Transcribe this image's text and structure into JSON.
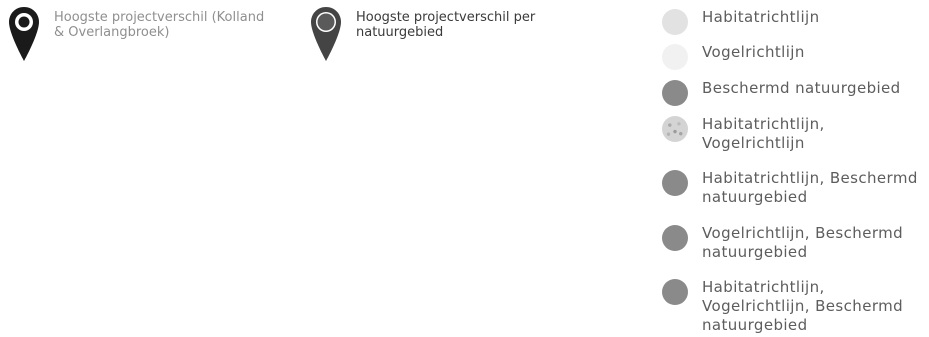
{
  "pin_legend": [
    {
      "label": "Hoogste projectverschil (Kolland\n& Overlangbroek)",
      "pin_color": "#1a1a1a",
      "center_style": "ring",
      "text_color": "#8f8f8f"
    },
    {
      "label": "Hoogste projectverschil per\nnatuurgebied",
      "pin_color": "#444444",
      "center_style": "filled",
      "text_color": "#3a3a3a"
    }
  ],
  "area_legend": [
    {
      "label": "Habitatrichtlijn",
      "color": "#e2e2e2",
      "pattern": "solid"
    },
    {
      "label": "Vogelrichtlijn",
      "color": "#f1f1f1",
      "pattern": "solid"
    },
    {
      "label": "Beschermd natuurgebied",
      "color": "#8a8a8a",
      "pattern": "solid"
    },
    {
      "label": "Habitatrichtlijn,\nVogelrichtlijn",
      "color": "#d4d4d4",
      "pattern": "dotted"
    },
    {
      "label": "Habitatrichtlijn, Beschermd\nnatuurgebied",
      "color": "#8a8a8a",
      "pattern": "solid"
    },
    {
      "label": "Vogelrichtlijn, Beschermd\nnatuurgebied",
      "color": "#8a8a8a",
      "pattern": "solid"
    },
    {
      "label": "Habitatrichtlijn,\nVogelrichtlijn, Beschermd\nnatuurgebied",
      "color": "#8a8a8a",
      "pattern": "solid"
    }
  ]
}
